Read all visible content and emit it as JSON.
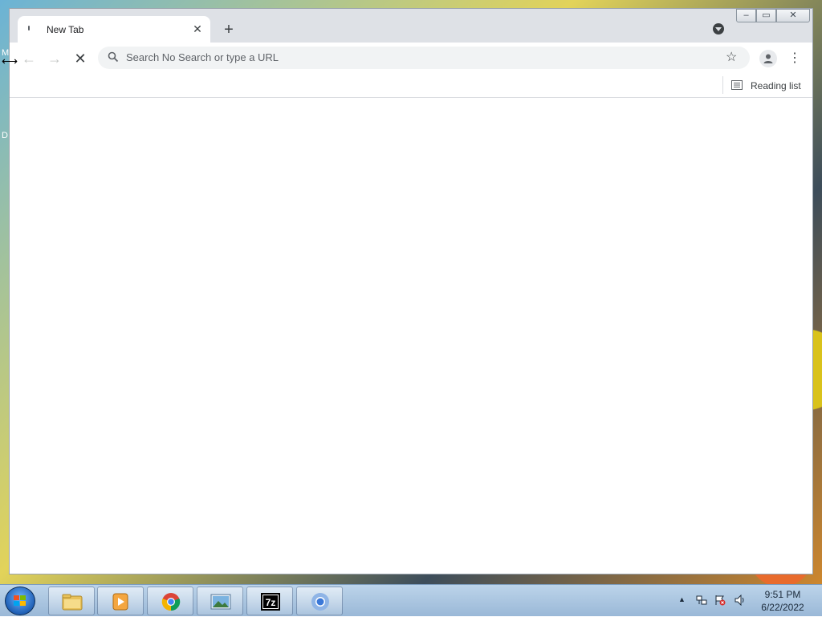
{
  "desktop": {
    "edge_letters": [
      "M",
      "D"
    ]
  },
  "browser": {
    "tab": {
      "title": "New Tab",
      "close_glyph": "✕"
    },
    "new_tab_glyph": "+",
    "tab_search_icon": "chevron-down-circle-icon",
    "window_controls": {
      "minimize": "‒",
      "maximize": "▭",
      "close": "✕"
    },
    "toolbar": {
      "back_glyph": "←",
      "forward_glyph": "→",
      "stop_glyph": "✕",
      "omnibox_placeholder": "Search No Search or type a URL",
      "bookmark_star_glyph": "☆",
      "menu_glyph": "⋮"
    },
    "bookmarks_bar": {
      "reading_list_label": "Reading list"
    }
  },
  "taskbar": {
    "items": [
      {
        "name": "windows-explorer",
        "icon": "folder-icon"
      },
      {
        "name": "media-player",
        "icon": "media-player-icon"
      },
      {
        "name": "google-chrome",
        "icon": "chrome-icon"
      },
      {
        "name": "photo-viewer",
        "icon": "photo-viewer-icon"
      },
      {
        "name": "7-zip",
        "icon": "7zip-icon",
        "label": "7z"
      },
      {
        "name": "chromium",
        "icon": "chromium-icon"
      }
    ],
    "tray": {
      "time": "9:51 PM",
      "date": "6/22/2022"
    }
  },
  "colors": {
    "tabstrip": "#dee1e6",
    "omnibox": "#f1f3f4",
    "taskbar": "#9ab8d7"
  }
}
